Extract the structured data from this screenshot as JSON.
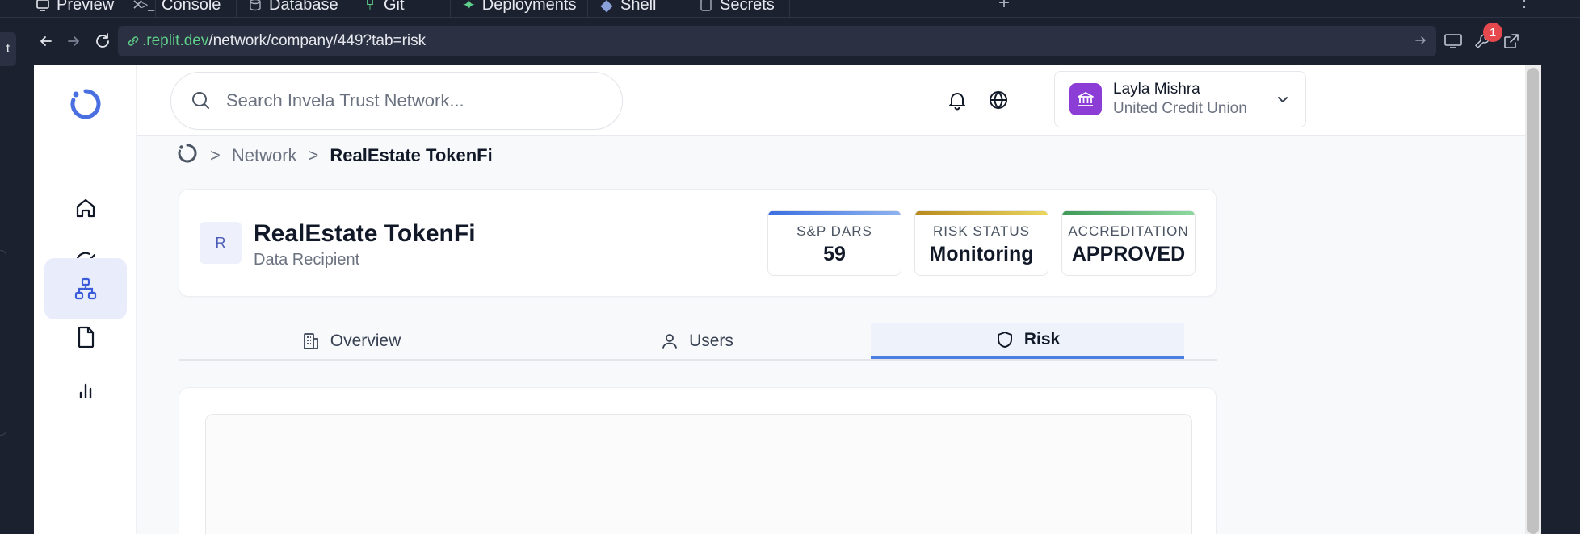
{
  "ide": {
    "tabs": [
      {
        "label": "Preview",
        "icon": "preview-icon",
        "closable": true
      },
      {
        "label": "Console",
        "icon": "terminal-icon"
      },
      {
        "label": "Database",
        "icon": "database-icon"
      },
      {
        "label": "Git",
        "icon": "git-icon"
      },
      {
        "label": "Deployments",
        "icon": "deploy-icon"
      },
      {
        "label": "Shell",
        "icon": "shell-icon"
      },
      {
        "label": "Secrets",
        "icon": "lock-icon"
      }
    ],
    "left_strip_label": "t",
    "address_bar": {
      "host": ".replit.dev",
      "path": "/network/company/449?tab=risk"
    },
    "notification_count": "1"
  },
  "app": {
    "search": {
      "placeholder": "Search Invela Trust Network..."
    },
    "user": {
      "name": "Layla Mishra",
      "org": "United Credit Union"
    },
    "sidebar": {
      "items": [
        {
          "name": "home",
          "icon": "home-icon",
          "active": false
        },
        {
          "name": "tasks",
          "icon": "check-circle-icon",
          "active": false
        },
        {
          "name": "network",
          "icon": "network-icon",
          "active": true
        },
        {
          "name": "files",
          "icon": "file-icon",
          "active": false
        },
        {
          "name": "insights",
          "icon": "bar-chart-icon",
          "active": false
        }
      ]
    },
    "breadcrumb": {
      "sep": ">",
      "link": "Network",
      "current": "RealEstate TokenFi"
    },
    "company": {
      "initial": "R",
      "name": "RealEstate TokenFi",
      "type": "Data Recipient",
      "stats": [
        {
          "label": "S&P DARS",
          "value": "59",
          "colors": [
            "#3b6fe0",
            "#8fb3f0"
          ]
        },
        {
          "label": "RISK STATUS",
          "value": "Monitoring",
          "colors": [
            "#b88a1e",
            "#ead65e"
          ]
        },
        {
          "label": "ACCREDITATION",
          "value": "APPROVED",
          "colors": [
            "#3f9a5a",
            "#8fd9a0"
          ]
        }
      ]
    },
    "tabs": [
      {
        "label": "Overview",
        "icon": "building-icon",
        "active": false
      },
      {
        "label": "Users",
        "icon": "user-icon",
        "active": false
      },
      {
        "label": "Risk",
        "icon": "shield-icon",
        "active": true
      }
    ]
  }
}
